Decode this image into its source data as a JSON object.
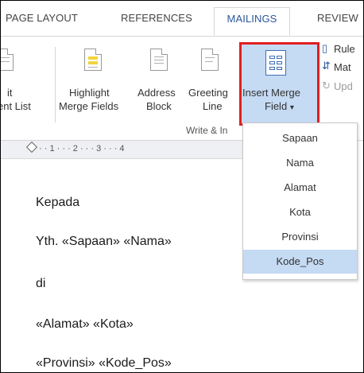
{
  "tabs": [
    "PAGE LAYOUT",
    "REFERENCES",
    "MAILINGS",
    "REVIEW"
  ],
  "ribbon": {
    "partial_left": {
      "line1": "it",
      "line2": "ent List"
    },
    "highlight": {
      "line1": "Highlight",
      "line2": "Merge Fields"
    },
    "address": {
      "line1": "Address",
      "line2": "Block"
    },
    "greeting": {
      "line1": "Greeting",
      "line2": "Line"
    },
    "insert_merge": {
      "line1": "Insert Merge",
      "line2": "Field",
      "caret": "▾"
    },
    "group_label": "Write & In",
    "right_items": [
      {
        "label": "Rule",
        "icon": "rules-icon"
      },
      {
        "label": "Mat",
        "icon": "match-fields-icon"
      },
      {
        "label": "Upd",
        "icon": "update-labels-icon"
      }
    ]
  },
  "ruler": {
    "marks": "·  ·  1  ·  ·  ·  2  ·  ·  ·  3  ·  ·  ·  4"
  },
  "menu": {
    "items": [
      "Sapaan",
      "Nama",
      "Alamat",
      "Kota",
      "Provinsi",
      "Kode_Pos"
    ],
    "selected": "Kode_Pos"
  },
  "document": {
    "lines": [
      "Kepada",
      "Yth. «Sapaan» «Nama»",
      "di",
      "«Alamat» «Kota»",
      "«Provinsi» «Kode_Pos»"
    ]
  },
  "colors": {
    "accent": "#2b579a",
    "highlight": "#c5daf3",
    "callout": "#e02020"
  }
}
